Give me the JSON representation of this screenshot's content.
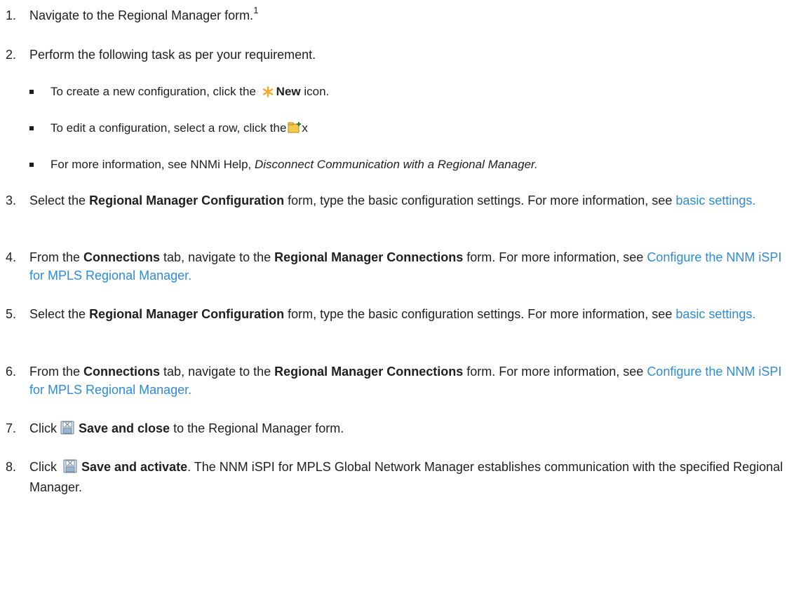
{
  "steps": [
    {
      "num": "1.",
      "before": "Navigate to the Regional Manager form.",
      "sup": "1"
    },
    {
      "num": "2.",
      "text": "Perform the following task as per your requirement."
    },
    {
      "num": "3.",
      "before": "Select the ",
      "bold": "Regional Manager Configuration",
      "after": " form, type the basic configuration settings. For more information, see ",
      "link": "basic settings."
    },
    {
      "num": "4.",
      "before": "From the ",
      "bold1": "Connections",
      "mid": " tab, navigate to the ",
      "bold2": "Regional Manager Connections",
      "after": " form. For more information, see ",
      "link": "Configure the NNM iSPI for MPLS Regional Manager."
    },
    {
      "num": "5.",
      "before": "Select the ",
      "bold": "Regional Manager Configuration",
      "after": " form, type the basic configuration settings. For more information, see ",
      "link": "basic settings."
    },
    {
      "num": "6.",
      "before": "From the ",
      "bold1": "Connections",
      "mid": " tab, navigate to the ",
      "bold2": "Regional Manager Connections",
      "after": " form. For more information, see ",
      "link": "Configure the NNM iSPI for MPLS Regional Manager."
    },
    {
      "num": "7.",
      "before": "Click ",
      "bold": "Save and close",
      "after": " to the Regional Manager form."
    },
    {
      "num": "8.",
      "before": "Click ",
      "bold": "Save and activate",
      "after": ". The NNM iSPI for MPLS Global Network Manager establishes communication with the specified Regional Manager."
    }
  ],
  "subitems": [
    {
      "before": "To create a new configuration, click the ",
      "bold": "New",
      "after": " icon.",
      "icon": "new-star-icon"
    },
    {
      "before": "To edit a configuration, select a row, click the",
      "after": "x",
      "icon": "open-folder-icon"
    },
    {
      "before": "For more information, see NNMi Help, ",
      "italic": "Disconnect Communication with a Regional Manager."
    }
  ],
  "icons": {
    "save": "save-icon",
    "accent_link": "#2e8bd8",
    "star": "#f5a623"
  }
}
